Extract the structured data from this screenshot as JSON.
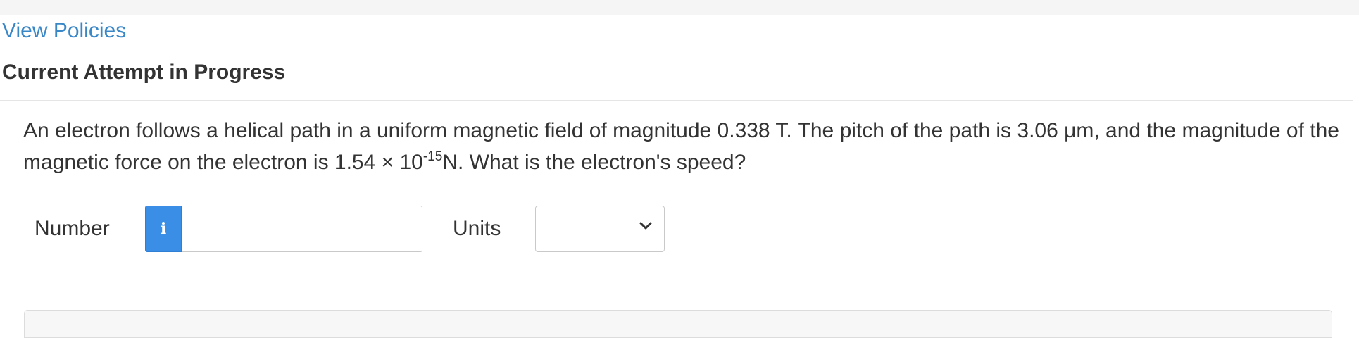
{
  "header": {
    "policies_link": "View Policies",
    "attempt_title": "Current Attempt in Progress"
  },
  "question": {
    "text_part1": "An electron follows a helical path in a uniform magnetic field of magnitude 0.338 T. The pitch of the path is 3.06 μm, and the magnitude of the magnetic force on the electron is 1.54 × 10",
    "exponent": "-15",
    "text_part2": "N. What is the electron's speed?"
  },
  "answer": {
    "number_label": "Number",
    "info_icon": "info-icon",
    "info_glyph": "i",
    "number_value": "",
    "units_label": "Units",
    "units_selected": "",
    "chevron_icon": "chevron-down-icon"
  },
  "colors": {
    "link": "#3a87c8",
    "info_button": "#3a8ee6",
    "text": "#333333"
  }
}
